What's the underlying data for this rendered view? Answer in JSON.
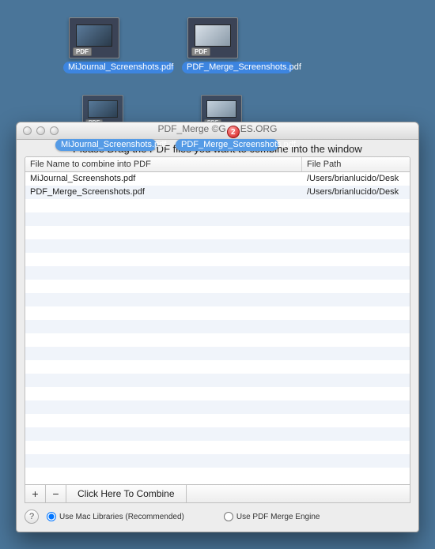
{
  "desktop": {
    "icons": [
      {
        "label": "MiJournal_Screenshots.pdf",
        "badge": "PDF"
      },
      {
        "label": "PDF_Merge_Screenshots.pdf",
        "badge": "PDF"
      }
    ]
  },
  "drag": {
    "badge": "PDF",
    "count": "2",
    "ghost_labels": [
      "MiJournal_Screenshots.pdf",
      "PDF_Merge_Screenshots.pdf"
    ]
  },
  "window": {
    "title_prefix": "PDF_Merge ©G",
    "title_suffix": "ES.ORG",
    "instruction": "Please Drag the PDF files you want to combine into the window",
    "columns": {
      "name": "File Name to combine into PDF",
      "path": "File Path"
    },
    "rows": [
      {
        "name": "MiJournal_Screenshots.pdf",
        "path": "/Users/brianlucido/Desk"
      },
      {
        "name": "PDF_Merge_Screenshots.pdf",
        "path": "/Users/brianlucido/Desk"
      }
    ],
    "buttons": {
      "add": "+",
      "remove": "−",
      "combine": "Click Here To Combine",
      "help": "?"
    },
    "radios": {
      "mac": "Use Mac Libraries (Recommended)",
      "engine": "Use PDF Merge Engine"
    }
  }
}
